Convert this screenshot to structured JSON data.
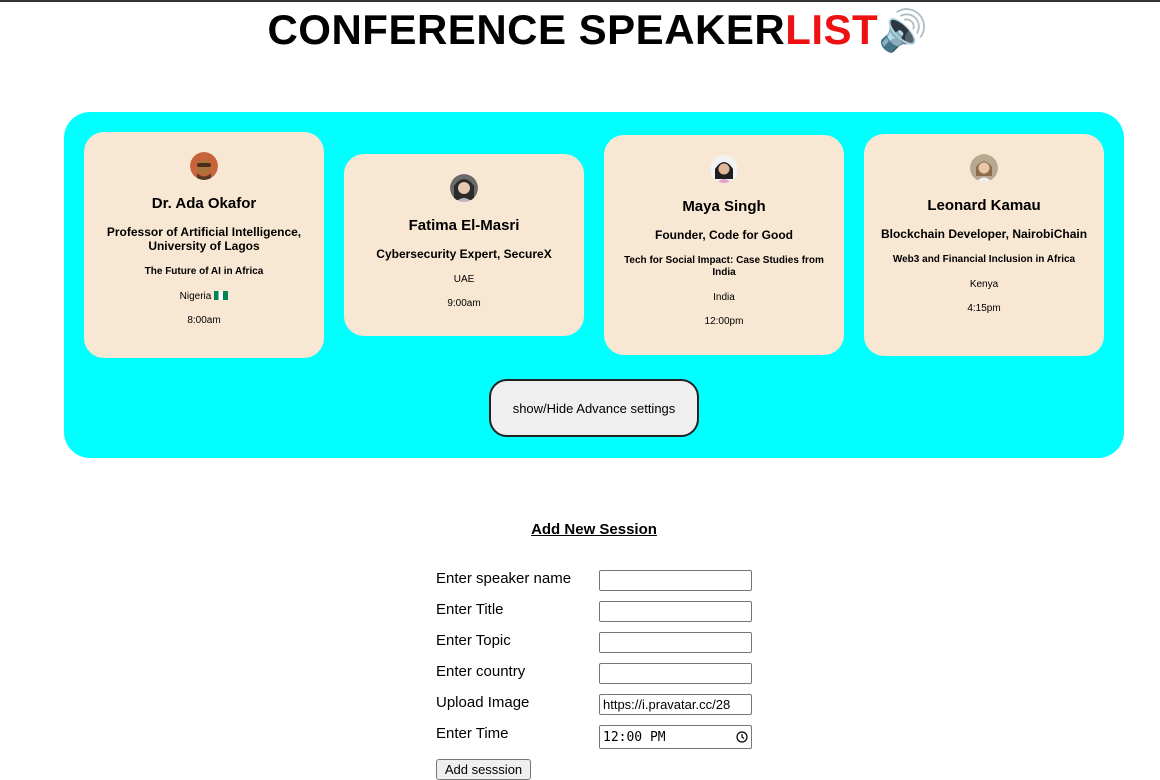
{
  "page": {
    "title_main": "CONFERENCE SPEAKER",
    "title_accent": "LIST",
    "title_emoji": "🔊"
  },
  "speakers": [
    {
      "name": "Dr. Ada Okafor",
      "title": "Professor of Artificial Intelligence, University of Lagos",
      "topic": "The Future of AI in Africa",
      "country": "Nigeria",
      "time": "8:00am"
    },
    {
      "name": "Fatima El-Masri",
      "title": "Cybersecurity Expert, SecureX",
      "topic": "",
      "country": "UAE",
      "time": "9:00am"
    },
    {
      "name": "Maya Singh",
      "title": "Founder, Code for Good",
      "topic": "Tech for Social Impact: Case Studies from India",
      "country": "India",
      "time": "12:00pm"
    },
    {
      "name": "Leonard Kamau",
      "title": "Blockchain Developer, NairobiChain",
      "topic": "Web3 and Financial Inclusion in Africa",
      "country": "Kenya",
      "time": "4:15pm"
    }
  ],
  "toggle_label": "show/Hide Advance settings",
  "form": {
    "heading": "Add New Session",
    "labels": {
      "name": "Enter speaker name",
      "title": "Enter Title",
      "topic": "Enter Topic",
      "country": "Enter country",
      "image": "Upload Image",
      "time": "Enter Time"
    },
    "values": {
      "name": "",
      "title": "",
      "topic": "",
      "country": "",
      "image": "https://i.pravatar.cc/28",
      "time": "12:00 PM"
    },
    "submit_label": "Add sesssion"
  },
  "colors": {
    "panel": "#00ffff",
    "card": "#f8e7d3",
    "accent": "#ee1111"
  }
}
